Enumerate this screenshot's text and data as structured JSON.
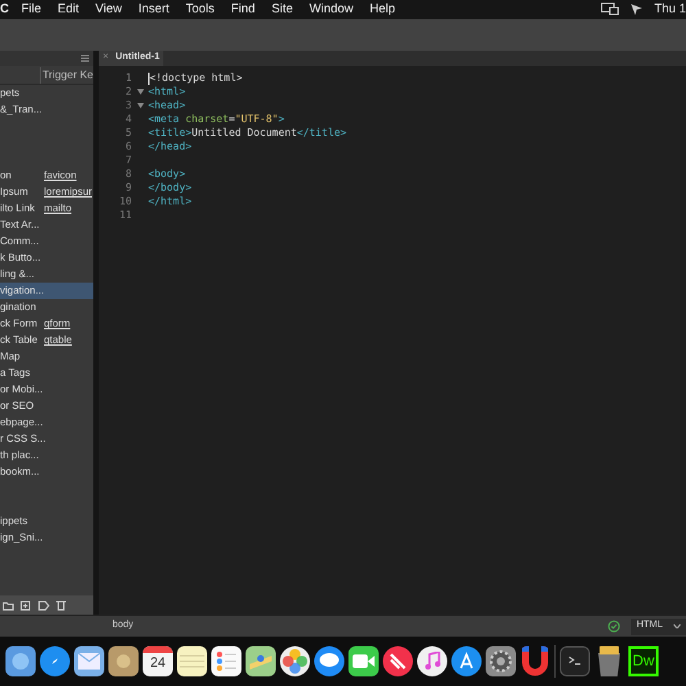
{
  "menu_bar": {
    "app": "C",
    "items": [
      "File",
      "Edit",
      "View",
      "Insert",
      "Tools",
      "Find",
      "Site",
      "Window",
      "Help"
    ],
    "clock": "Thu 1"
  },
  "snippets_panel": {
    "column_header": "Trigger Ke",
    "rows": [
      {
        "name": "pets",
        "selected": false
      },
      {
        "name": "&_Tran...",
        "selected": false
      },
      {
        "selected": false
      },
      {
        "selected": false
      },
      {
        "selected": false
      },
      {
        "name": "on",
        "trigger": "favicon",
        "selected": false
      },
      {
        "name": "Ipsum",
        "trigger": "loremipsur",
        "selected": false
      },
      {
        "name": "ilto Link",
        "trigger": "mailto",
        "selected": false
      },
      {
        "name": "Text Ar...",
        "selected": false
      },
      {
        "name": "Comm...",
        "selected": false
      },
      {
        "name": "k Butto...",
        "selected": false
      },
      {
        "name": "ling &...",
        "selected": false
      },
      {
        "name": "vigation...",
        "selected": true
      },
      {
        "name": "gination",
        "selected": false
      },
      {
        "name": "ck Form",
        "trigger": "qform",
        "selected": false
      },
      {
        "name": "ck Table",
        "trigger": "qtable",
        "selected": false
      },
      {
        "name": "Map",
        "selected": false
      },
      {
        "name": "a Tags",
        "selected": false
      },
      {
        "name": "or Mobi...",
        "selected": false
      },
      {
        "name": "or SEO",
        "selected": false
      },
      {
        "name": "ebpage...",
        "selected": false
      },
      {
        "name": "r CSS S...",
        "selected": false
      },
      {
        "name": "th plac...",
        "selected": false
      },
      {
        "name": " bookm...",
        "selected": false
      },
      {
        "selected": false
      },
      {
        "selected": false
      },
      {
        "name": "ippets",
        "selected": false
      },
      {
        "name": "ign_Sni...",
        "selected": false
      }
    ]
  },
  "editor": {
    "tab": {
      "close": "×",
      "title": "Untitled-1",
      "selected": true
    },
    "lines": [
      {
        "number": "1",
        "fold": false,
        "tokens": [
          {
            "kind": "plain",
            "text": "<!doctype html>"
          }
        ]
      },
      {
        "number": "2",
        "fold": true,
        "tokens": [
          {
            "kind": "tag",
            "text": "<html>"
          }
        ]
      },
      {
        "number": "3",
        "fold": true,
        "tokens": [
          {
            "kind": "tag",
            "text": "<head>"
          }
        ]
      },
      {
        "number": "4",
        "fold": false,
        "tokens": [
          {
            "kind": "tag",
            "text": "<meta "
          },
          {
            "kind": "attr",
            "text": "charset"
          },
          {
            "kind": "plain",
            "text": "="
          },
          {
            "kind": "string",
            "text": "\"UTF-8\""
          },
          {
            "kind": "tag",
            "text": ">"
          }
        ]
      },
      {
        "number": "5",
        "fold": false,
        "tokens": [
          {
            "kind": "tag",
            "text": "<title>"
          },
          {
            "kind": "plain",
            "text": "Untitled Document"
          },
          {
            "kind": "tag",
            "text": "</title>"
          }
        ]
      },
      {
        "number": "6",
        "fold": false,
        "tokens": [
          {
            "kind": "tag",
            "text": "</head>"
          }
        ]
      },
      {
        "number": "7",
        "fold": false
      },
      {
        "number": "8",
        "fold": false,
        "tokens": [
          {
            "kind": "tag",
            "text": "<body>"
          }
        ]
      },
      {
        "number": "9",
        "fold": false,
        "tokens": [
          {
            "kind": "tag",
            "text": "</body>"
          }
        ]
      },
      {
        "number": "10",
        "fold": false,
        "tokens": [
          {
            "kind": "tag",
            "text": "</html>"
          }
        ]
      },
      {
        "number": "11",
        "fold": false
      }
    ]
  },
  "status_bar": {
    "tag_selector": "body",
    "language": "HTML"
  },
  "dock": {
    "calendar_day": "24",
    "last_app": "Dw"
  }
}
